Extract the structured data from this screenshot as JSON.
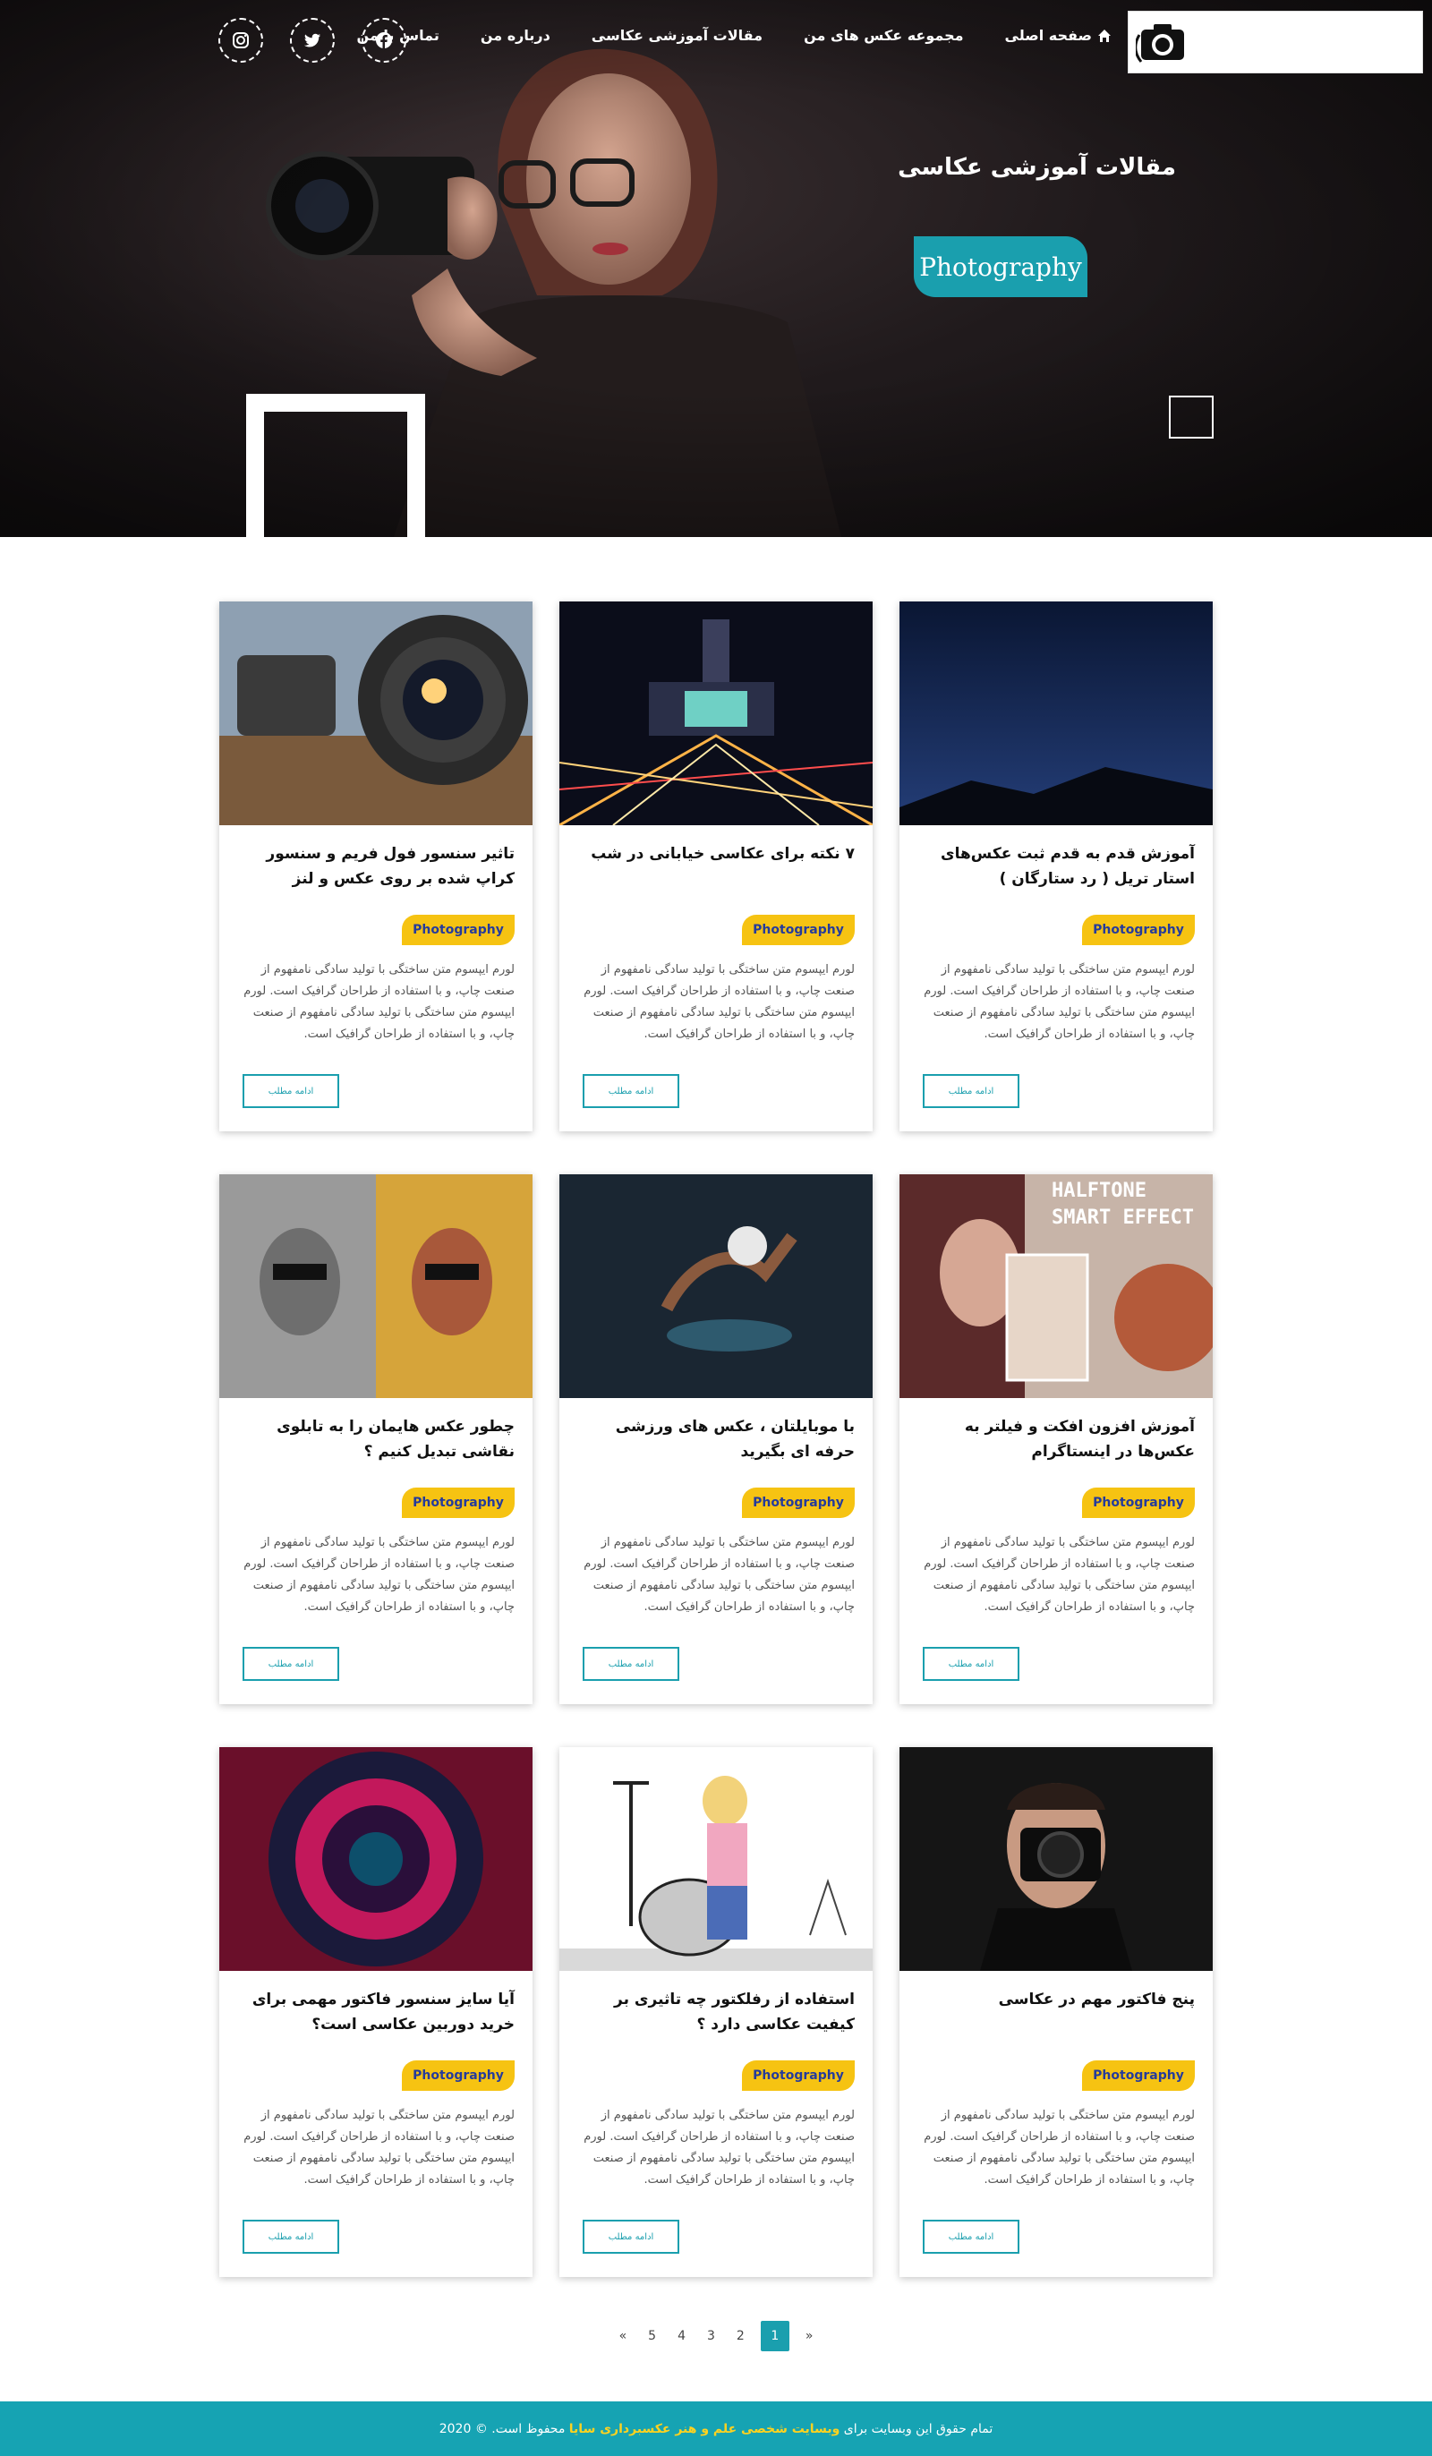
{
  "colors": {
    "accent": "#1a9fae",
    "tag": "#f6c312",
    "tag_text": "#253b9c",
    "footer": "#16a3b3",
    "footer_highlight": "#ffd21f"
  },
  "nav": {
    "items": [
      {
        "label": "صفحه اصلی",
        "icon": "home-icon"
      },
      {
        "label": "مجموعه عکس های من"
      },
      {
        "label": "مقالات آموزشی عکاسی"
      },
      {
        "label": "درباره من"
      },
      {
        "label": "تماس با من"
      }
    ],
    "socials": [
      "facebook-icon",
      "twitter-icon",
      "instagram-icon"
    ]
  },
  "hero": {
    "title": "مقالات آموزشی عکاسی",
    "badge": "Photography"
  },
  "cards": [
    {
      "title": "آموزش قدم به قدم ثبت عکس‌های استار تریل ( رد ستارگان )",
      "tag": "Photography",
      "text": "لورم ایپسوم متن ساختگی با تولید سادگی نامفهوم از صنعت چاپ، و با استفاده از طراحان گرافیک است. لورم ایپسوم متن ساختگی با تولید سادگی نامفهوم از صنعت چاپ، و با استفاده از طراحان گرافیک است.",
      "button": "ادامه مطلب"
    },
    {
      "title": "۷ نکته برای عکاسی خیابانی در شب",
      "tag": "Photography",
      "text": "لورم ایپسوم متن ساختگی با تولید سادگی نامفهوم از صنعت چاپ، و با استفاده از طراحان گرافیک است. لورم ایپسوم متن ساختگی با تولید سادگی نامفهوم از صنعت چاپ، و با استفاده از طراحان گرافیک است.",
      "button": "ادامه مطلب"
    },
    {
      "title": "تاثیر سنسور فول فریم و سنسور کراپ شده بر روی عکس و لنز",
      "tag": "Photography",
      "text": "لورم ایپسوم متن ساختگی با تولید سادگی نامفهوم از صنعت چاپ، و با استفاده از طراحان گرافیک است. لورم ایپسوم متن ساختگی با تولید سادگی نامفهوم از صنعت چاپ، و با استفاده از طراحان گرافیک است.",
      "button": "ادامه مطلب"
    },
    {
      "title": "آموزش افزون افکت و فیلتر به عکس‌ها در اینستاگرام",
      "tag": "Photography",
      "text": "لورم ایپسوم متن ساختگی با تولید سادگی نامفهوم از صنعت چاپ، و با استفاده از طراحان گرافیک است. لورم ایپسوم متن ساختگی با تولید سادگی نامفهوم از صنعت چاپ، و با استفاده از طراحان گرافیک است.",
      "button": "ادامه مطلب"
    },
    {
      "title": "با موبایلتان ، عکس های ورزشی حرفه ای بگیرید",
      "tag": "Photography",
      "text": "لورم ایپسوم متن ساختگی با تولید سادگی نامفهوم از صنعت چاپ، و با استفاده از طراحان گرافیک است. لورم ایپسوم متن ساختگی با تولید سادگی نامفهوم از صنعت چاپ، و با استفاده از طراحان گرافیک است.",
      "button": "ادامه مطلب"
    },
    {
      "title": "چطور عکس هایمان را به تابلوی نقاشی تبدیل کنیم ؟",
      "tag": "Photography",
      "text": "لورم ایپسوم متن ساختگی با تولید سادگی نامفهوم از صنعت چاپ، و با استفاده از طراحان گرافیک است. لورم ایپسوم متن ساختگی با تولید سادگی نامفهوم از صنعت چاپ، و با استفاده از طراحان گرافیک است.",
      "button": "ادامه مطلب"
    },
    {
      "title": "پنج فاکتور مهم در عکاسی",
      "tag": "Photography",
      "text": "لورم ایپسوم متن ساختگی با تولید سادگی نامفهوم از صنعت چاپ، و با استفاده از طراحان گرافیک است. لورم ایپسوم متن ساختگی با تولید سادگی نامفهوم از صنعت چاپ، و با استفاده از طراحان گرافیک است.",
      "button": "ادامه مطلب"
    },
    {
      "title": "استفاده از رفلکتور چه تاثیری بر کیفیت عکاسی دارد ؟",
      "tag": "Photography",
      "text": "لورم ایپسوم متن ساختگی با تولید سادگی نامفهوم از صنعت چاپ، و با استفاده از طراحان گرافیک است. لورم ایپسوم متن ساختگی با تولید سادگی نامفهوم از صنعت چاپ، و با استفاده از طراحان گرافیک است.",
      "button": "ادامه مطلب"
    },
    {
      "title": "آیا سایز سنسور فاکتور مهمی برای خرید دوربین عکاسی است؟",
      "tag": "Photography",
      "text": "لورم ایپسوم متن ساختگی با تولید سادگی نامفهوم از صنعت چاپ، و با استفاده از طراحان گرافیک است. لورم ایپسوم متن ساختگی با تولید سادگی نامفهوم از صنعت چاپ، و با استفاده از طراحان گرافیک است.",
      "button": "ادامه مطلب"
    }
  ],
  "card_images": [
    {
      "name": "star-trail-image",
      "theme": "night-sky"
    },
    {
      "name": "night-street-image",
      "theme": "city-night"
    },
    {
      "name": "camera-lens-image",
      "theme": "lens"
    },
    {
      "name": "halftone-effect-image",
      "theme": "halftone",
      "caption": "HALFTONE SMART EFFECT"
    },
    {
      "name": "sport-photo-image",
      "theme": "sport"
    },
    {
      "name": "painting-portrait-image",
      "theme": "portrait-split"
    },
    {
      "name": "photographer-image",
      "theme": "photographer"
    },
    {
      "name": "reflector-illustration-image",
      "theme": "reflector"
    },
    {
      "name": "colorful-lens-image",
      "theme": "lens-color"
    }
  ],
  "pagination": {
    "prev": "«",
    "pages": [
      "5",
      "4",
      "3",
      "2",
      "1"
    ],
    "active": "1",
    "next": "»"
  },
  "footer": {
    "prefix": "تمام حقوق این وبسایت برای",
    "highlight": "وبسایت شخصی علم و هنر عکسبرداری سایا",
    "suffix": "محفوظ است. © 2020"
  }
}
